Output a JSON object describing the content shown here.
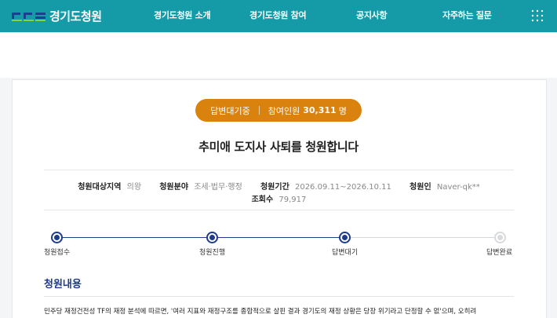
{
  "header": {
    "logo_text": "경기도청원",
    "nav": [
      "경기도청원 소개",
      "경기도청원 참여",
      "공지사항",
      "자주하는 질문"
    ],
    "menu_icon": "grid-menu-icon",
    "brand_color": "#159ba7"
  },
  "petition": {
    "status": "답변대기중",
    "participants_label": "참여인원",
    "participants_count": "30,311",
    "participants_unit": "명",
    "status_color": "#d9820e",
    "title": "추미애 도지사 사퇴를 청원합니다",
    "info": {
      "region_label": "청원대상지역",
      "region_value": "의왕",
      "field_label": "청원분야",
      "field_value": "조세·법무·행정",
      "period_label": "청원기간",
      "period_value": "2026.09.11~2026.10.11",
      "author_label": "청원인",
      "author_value": "Naver-qk**",
      "views_label": "조회수",
      "views_value": "79,917"
    }
  },
  "progress": {
    "steps": [
      "청원접수",
      "청원진행",
      "답변대기",
      "답변완료"
    ],
    "completed_steps": 3,
    "active_color": "#1f3c88"
  },
  "content": {
    "section_title": "청원내용",
    "body_first_line": "민주당 재정건전성 TF의 재정 분석에 따르면, '여러 지표와 재정구조를 종합적으로 살핀 결과 경기도의 재정 상황은 당장 위기라고 단정할 수 없'으며, 오히려"
  }
}
